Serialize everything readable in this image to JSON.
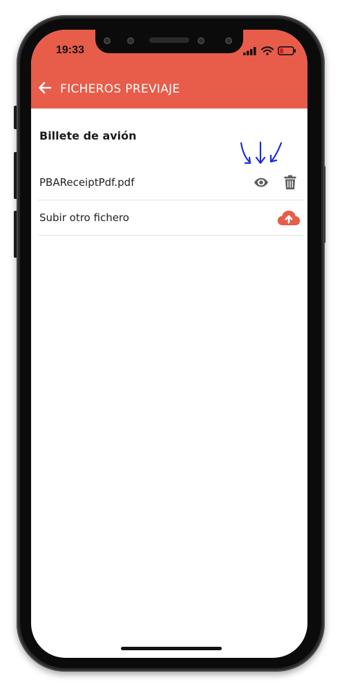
{
  "status_bar": {
    "time": "19:33"
  },
  "header": {
    "title": "FICHEROS PREVIAJE",
    "back_icon": "arrow-left-icon",
    "color": "#e85c4a"
  },
  "section": {
    "title": "Billete de avión"
  },
  "files": [
    {
      "name": "PBAReceiptPdf.pdf",
      "actions": [
        "eye-icon",
        "trash-icon"
      ]
    }
  ],
  "upload": {
    "label": "Subir otro fichero",
    "icon": "cloud-upload-icon",
    "color": "#e85c4a"
  },
  "annotation": {
    "arrows_color": "#1a2bd6"
  }
}
